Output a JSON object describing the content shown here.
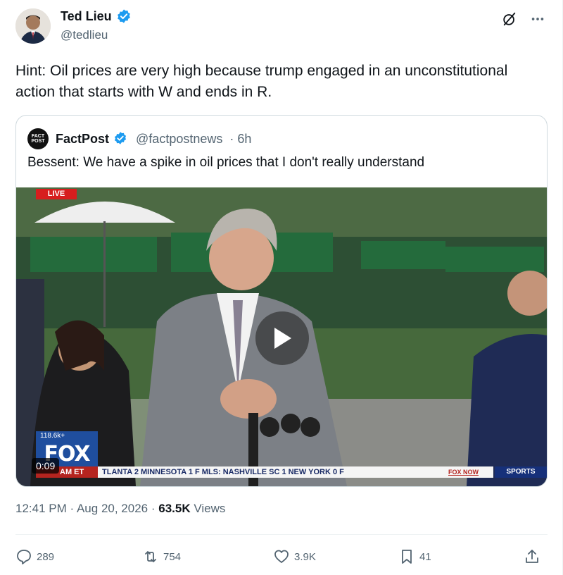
{
  "author": {
    "display_name": "Ted Lieu",
    "handle": "@tedlieu",
    "verified": true
  },
  "tweet": {
    "text": "Hint: Oil prices are very high because trump engaged in an unconstitutional action that starts with W and ends in R."
  },
  "quote": {
    "avatar_text": "FACT POST",
    "display_name": "FactPost",
    "handle": "@factpostnews",
    "time": "· 6h",
    "text": "Bessent: We have a spike in oil prices that I don't really understand",
    "media": {
      "live_label": "LIVE",
      "views_chip": "118.6k+",
      "network_logo": "FOX",
      "duration": "0:09",
      "ticker_time": "AM ET",
      "ticker_text": "TLANTA  2  MINNESOTA  1  F MLS:  NASHVILLE SC  1  NEW YORK  0  F",
      "inow_label": "FOX NOW",
      "sports_label": "SPORTS"
    }
  },
  "meta": {
    "time": "12:41 PM",
    "date": "Aug 20, 2026",
    "separator": "·",
    "views_count": "63.5K",
    "views_label": "Views"
  },
  "actions": {
    "replies": "289",
    "reposts": "754",
    "likes": "3.9K",
    "bookmarks": "41"
  },
  "colors": {
    "verified_blue": "#1d9bf0",
    "text_primary": "#0f1419",
    "text_secondary": "#536471",
    "border": "#cfd9de"
  },
  "icons": {
    "grok": "grok-icon",
    "more": "more-icon",
    "reply": "reply-icon",
    "repost": "repost-icon",
    "like": "heart-icon",
    "bookmark": "bookmark-icon",
    "share": "share-icon",
    "play": "play-icon"
  }
}
